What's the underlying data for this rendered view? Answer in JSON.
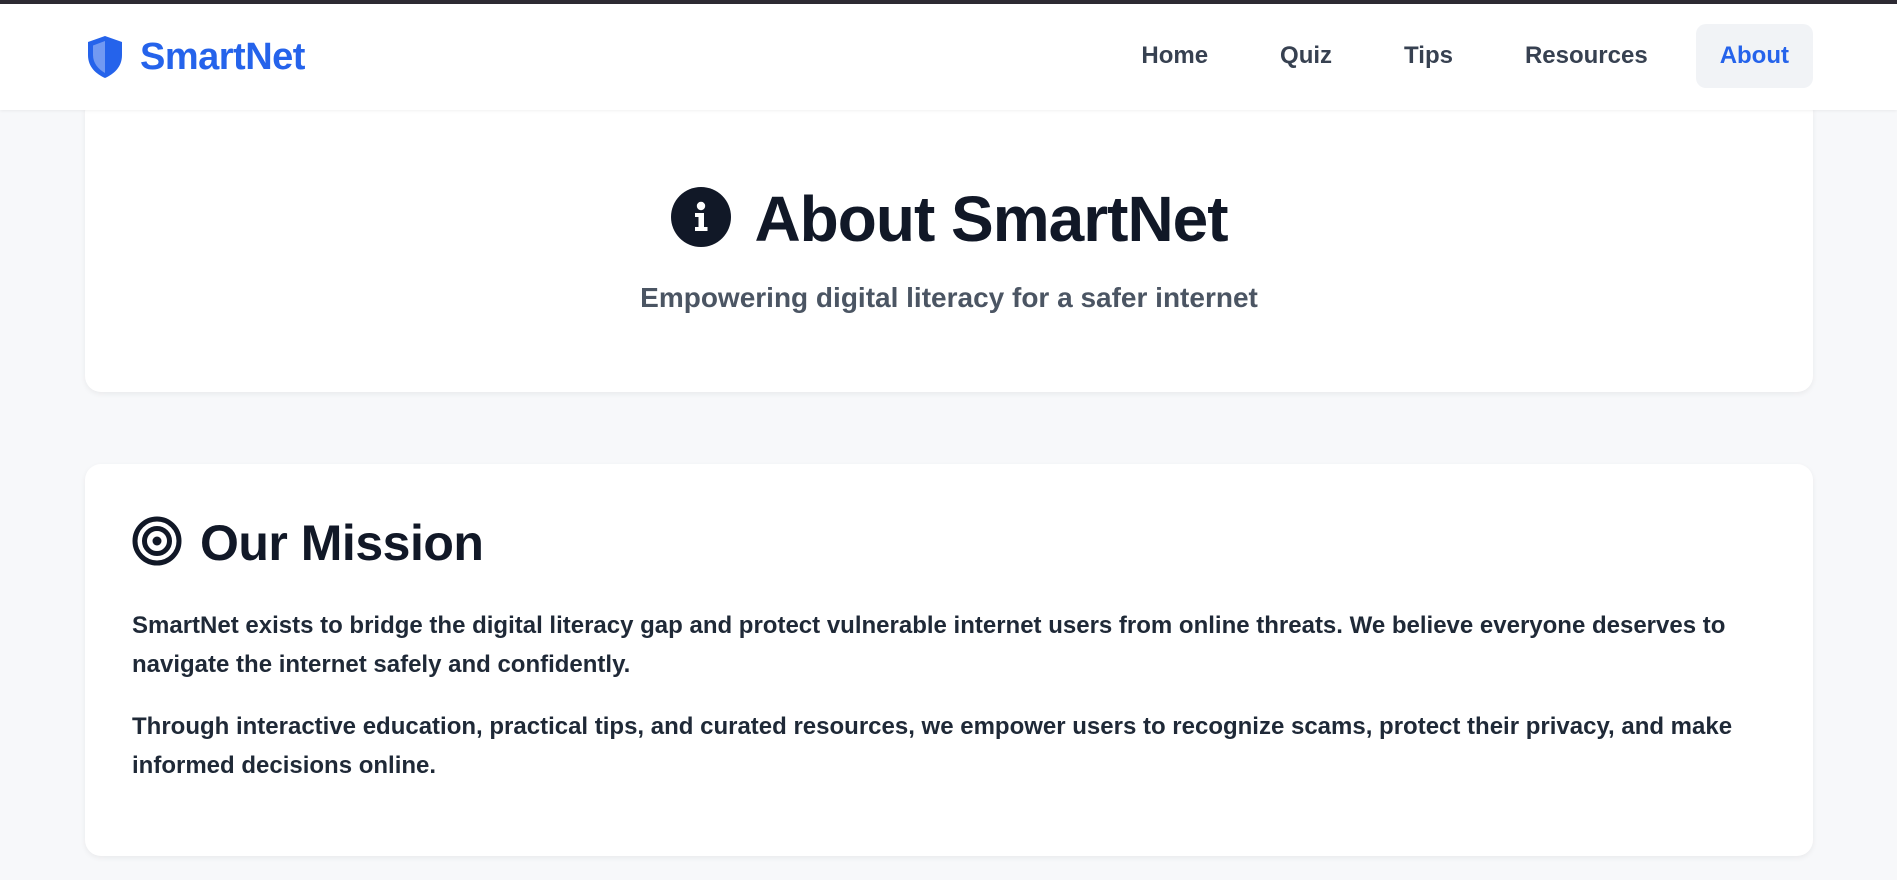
{
  "brand": {
    "name": "SmartNet",
    "icon": "shield-icon",
    "color": "#2563eb"
  },
  "nav": {
    "items": [
      {
        "label": "Home"
      },
      {
        "label": "Quiz"
      },
      {
        "label": "Tips"
      },
      {
        "label": "Resources"
      },
      {
        "label": "About",
        "active": true
      }
    ]
  },
  "hero": {
    "icon": "info-icon",
    "title": "About SmartNet",
    "subtitle": "Empowering digital literacy for a safer internet"
  },
  "mission": {
    "icon": "target-icon",
    "title": "Our Mission",
    "paragraphs": [
      "SmartNet exists to bridge the digital literacy gap and protect vulnerable internet users from online threats. We believe everyone deserves to navigate the internet safely and confidently.",
      "Through interactive education, practical tips, and curated resources, we empower users to recognize scams, protect their privacy, and make informed decisions online."
    ]
  },
  "colors": {
    "accent": "#2563eb",
    "text": "#111827",
    "muted": "#4b5563",
    "background": "#f7f8fa"
  }
}
